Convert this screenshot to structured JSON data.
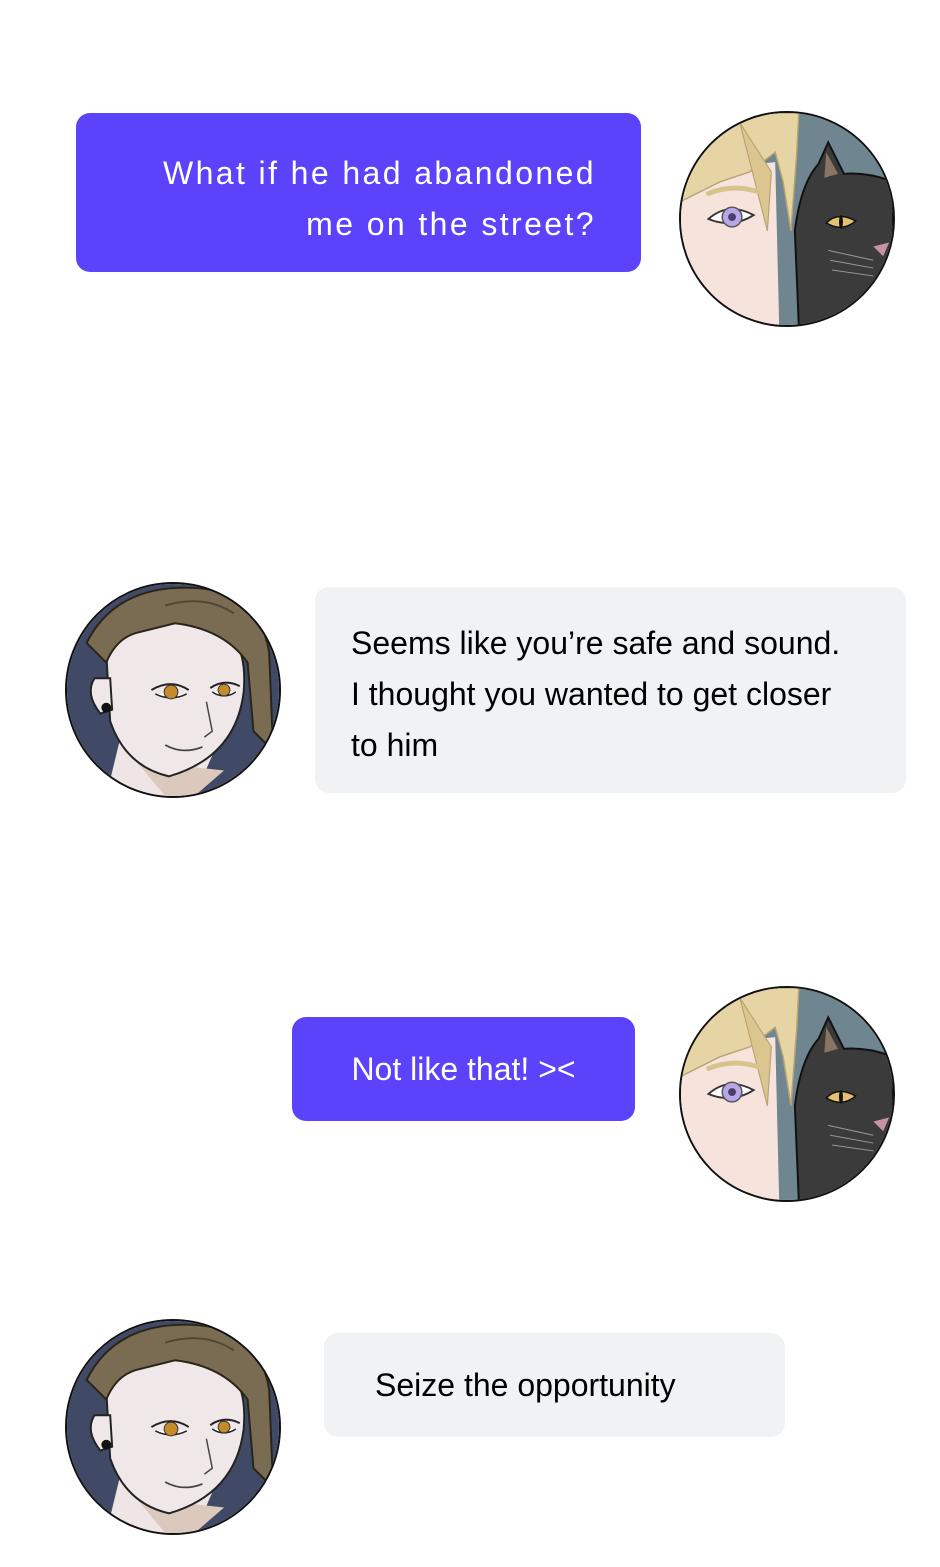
{
  "messages": [
    {
      "sender": "me",
      "lines": [
        "What if he had abandoned",
        "me on the street?"
      ],
      "avatar": "blonde-with-black-cat-avatar"
    },
    {
      "sender": "them",
      "lines": [
        "Seems like you’re safe and sound.",
        "I thought you wanted to get closer",
        "to him"
      ],
      "avatar": "brown-haired-man-avatar"
    },
    {
      "sender": "me",
      "lines": [
        "Not like that! ><"
      ],
      "avatar": "blonde-with-black-cat-avatar"
    },
    {
      "sender": "them",
      "lines": [
        "Seize the opportunity"
      ],
      "avatar": "brown-haired-man-avatar"
    }
  ],
  "colors": {
    "outgoing_bubble": "#5a43fb",
    "incoming_bubble": "#f1f2f4",
    "outgoing_text": "#ffffff",
    "incoming_text": "#000000"
  }
}
